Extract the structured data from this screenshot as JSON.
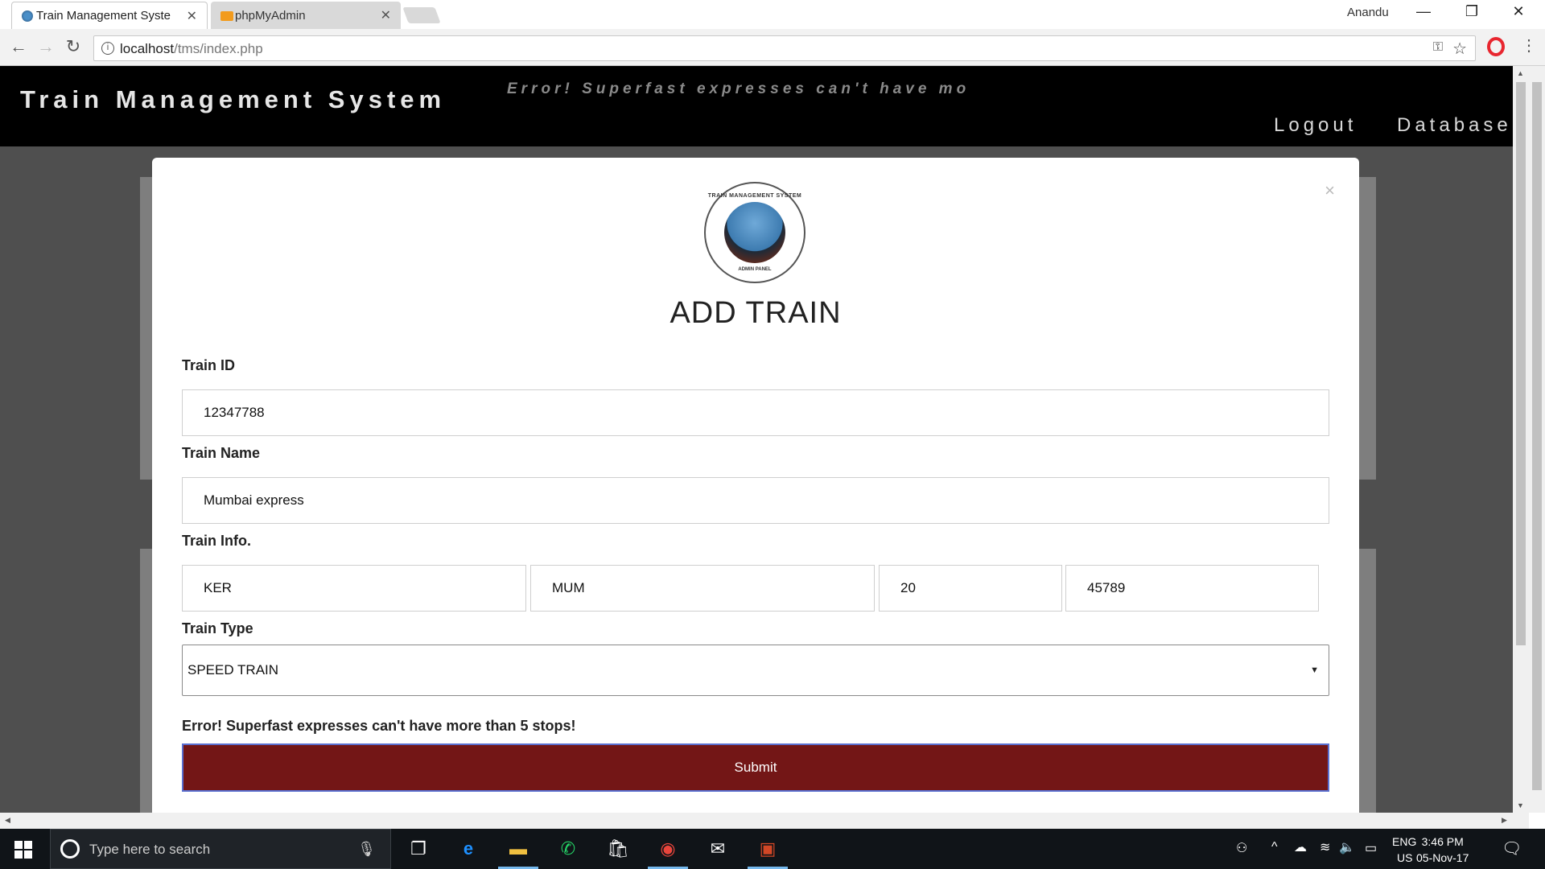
{
  "browser": {
    "tabs": [
      {
        "title": "Train Management Syste",
        "active": true
      },
      {
        "title": "phpMyAdmin",
        "active": false
      }
    ],
    "user": "Anandu",
    "url_host": "localhost",
    "url_path": "/tms/index.php",
    "window_controls": [
      "—",
      "❐",
      "✕"
    ]
  },
  "header": {
    "title": "Train Management System",
    "marquee": "Error! Superfast expresses can't have more",
    "nav": [
      "Logout",
      "Database"
    ]
  },
  "modal": {
    "close": "×",
    "logo_text_top": "TRAIN MANAGEMENT SYSTEM",
    "logo_text_bottom": "ADMIN PANEL",
    "title": "ADD TRAIN",
    "fields": {
      "train_id_label": "Train ID",
      "train_id_value": "12347788",
      "train_name_label": "Train Name",
      "train_name_value": "Mumbai express",
      "train_info_label": "Train Info.",
      "train_info_values": [
        "KER",
        "MUM",
        "20",
        "45789"
      ],
      "train_type_label": "Train Type",
      "train_type_value": "SPEED TRAIN"
    },
    "error": "Error! Superfast expresses can't have more than 5 stops!",
    "submit": "Submit"
  },
  "taskbar": {
    "search_placeholder": "Type here to search",
    "lang_top": "ENG",
    "lang_bottom": "US",
    "time": "3:46 PM",
    "date": "05-Nov-17"
  },
  "colors": {
    "header_bg": "#000000",
    "submit_bg": "#731616",
    "backdrop": "#4f4f4f"
  }
}
